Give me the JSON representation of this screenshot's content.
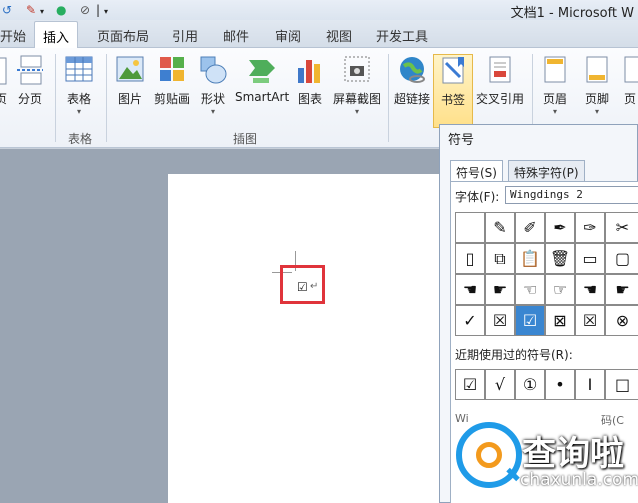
{
  "window": {
    "title": "文档1 - Microsoft W"
  },
  "quick_access": {
    "separator": "|",
    "dropdown": "▾"
  },
  "tabs": [
    {
      "label": "开始",
      "active": false
    },
    {
      "label": "插入",
      "active": true
    },
    {
      "label": "页面布局",
      "active": false
    },
    {
      "label": "引用",
      "active": false
    },
    {
      "label": "邮件",
      "active": false
    },
    {
      "label": "审阅",
      "active": false
    },
    {
      "label": "视图",
      "active": false
    },
    {
      "label": "开发工具",
      "active": false
    }
  ],
  "ribbon": {
    "buttons": {
      "page_partial": "页",
      "page_break": "分页",
      "table": "表格",
      "picture": "图片",
      "clipart": "剪贴画",
      "shapes": "形状",
      "smartart": "SmartArt",
      "chart": "图表",
      "screenshot": "屏幕截图",
      "hyperlink": "超链接",
      "bookmark": "书签",
      "crossref": "交叉引用",
      "header": "页眉",
      "footer": "页脚",
      "pagenum_partial": "页"
    },
    "groups": {
      "table": "表格",
      "illustrations": "插图"
    },
    "caret": "▾"
  },
  "document": {
    "inserted_symbol": "☑",
    "para_mark": "↵"
  },
  "dialog": {
    "title": "符号",
    "tabs": [
      "符号(S)",
      "特殊字符(P)"
    ],
    "font_label": "字体(F):",
    "font_value": "Wingdings 2",
    "symbol_rows": [
      [
        "",
        "✎",
        "✐",
        "✒",
        "✑",
        "✂"
      ],
      [
        "▯",
        "⧉",
        "📋",
        "🗑",
        "▭",
        "▢"
      ],
      [
        "☚",
        "☛",
        "☜",
        "☞",
        "☚",
        "☛"
      ],
      [
        "✓",
        "☒",
        "☑",
        "⊠",
        "☒",
        "⊗"
      ]
    ],
    "selected": "3-2",
    "recent_label": "近期使用过的符号(R):",
    "recent": [
      "☑",
      "√",
      "①",
      "•",
      "I",
      "□"
    ],
    "partial_left": "Wi",
    "partial_right": "码(C"
  },
  "watermark": {
    "text": "查询啦",
    "url": "chaxunla.com"
  }
}
